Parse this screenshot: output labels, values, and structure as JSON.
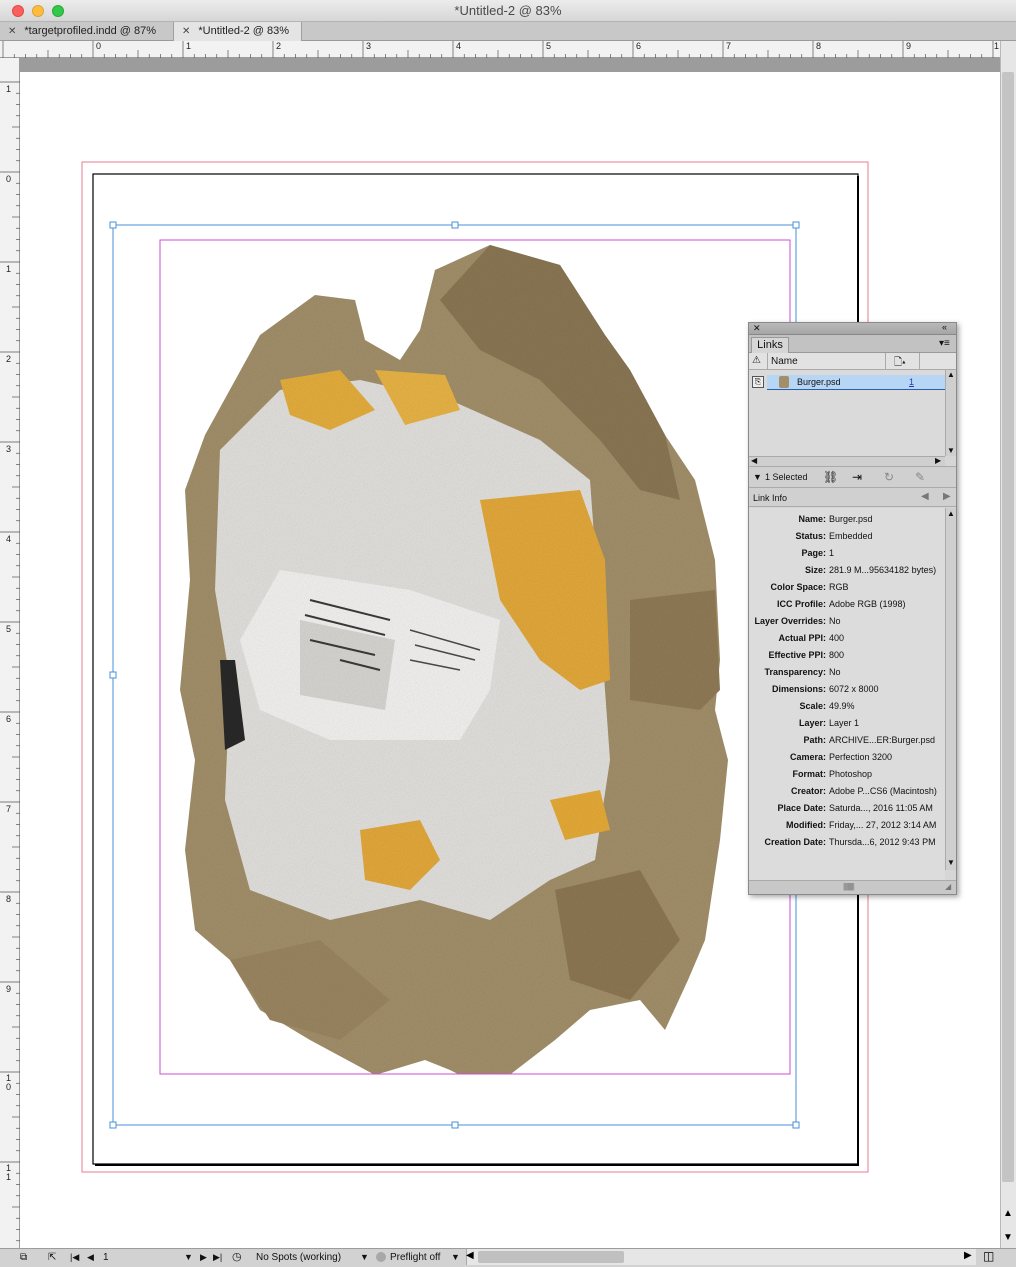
{
  "window": {
    "title": "*Untitled-2 @ 83%",
    "colors": {
      "close": "#fc605c",
      "minimize": "#fdbc40",
      "zoom": "#34c84a"
    }
  },
  "tabs": [
    {
      "label": "*targetprofiled.indd @ 87%",
      "active": false
    },
    {
      "label": "*Untitled-2 @ 83%",
      "active": true
    }
  ],
  "ruler": {
    "horizontal": [
      "0",
      "1",
      "2",
      "3",
      "4",
      "5",
      "6",
      "7",
      "8",
      "9",
      "1"
    ],
    "vertical": [
      "1",
      "0",
      "1",
      "2",
      "3",
      "4",
      "5",
      "6",
      "7",
      "8",
      "9",
      "1\n0",
      "1\n1"
    ]
  },
  "canvas": {
    "image_name": "Burger.psd",
    "colors": {
      "bleed": "#e8798e",
      "margin": "#cf4bd6",
      "frame": "#4a90d9",
      "page_edge": "#000000"
    }
  },
  "links_panel": {
    "tab": "Links",
    "column_name": "Name",
    "links": [
      {
        "name": "Burger.psd",
        "page": "1"
      }
    ],
    "selected_text": "1 Selected",
    "link_info_label": "Link Info",
    "info": [
      {
        "key": "Name:",
        "value": "Burger.psd"
      },
      {
        "key": "Status:",
        "value": "Embedded"
      },
      {
        "key": "Page:",
        "value": "1"
      },
      {
        "key": "Size:",
        "value": "281.9 M...95634182 bytes)"
      },
      {
        "key": "Color Space:",
        "value": "RGB"
      },
      {
        "key": "ICC Profile:",
        "value": "Adobe RGB (1998)"
      },
      {
        "key": "Layer Overrides:",
        "value": "No"
      },
      {
        "key": "Actual PPI:",
        "value": "400"
      },
      {
        "key": "Effective PPI:",
        "value": "800"
      },
      {
        "key": "Transparency:",
        "value": "No"
      },
      {
        "key": "Dimensions:",
        "value": "6072 x 8000"
      },
      {
        "key": "Scale:",
        "value": "49.9%"
      },
      {
        "key": "Layer:",
        "value": "Layer 1"
      },
      {
        "key": "Path:",
        "value": "ARCHIVE...ER:Burger.psd"
      },
      {
        "key": "Camera:",
        "value": "Perfection 3200"
      },
      {
        "key": "Format:",
        "value": "Photoshop"
      },
      {
        "key": "Creator:",
        "value": "Adobe P...CS6 (Macintosh)"
      },
      {
        "key": "Place Date:",
        "value": "Saturda..., 2016 11:05 AM"
      },
      {
        "key": "Modified:",
        "value": "Friday,... 27, 2012 3:14 AM"
      },
      {
        "key": "Creation Date:",
        "value": "Thursda...6, 2012 9:43 PM"
      }
    ]
  },
  "status": {
    "page": "1",
    "spots": "No Spots (working)",
    "preflight": "Preflight off"
  }
}
